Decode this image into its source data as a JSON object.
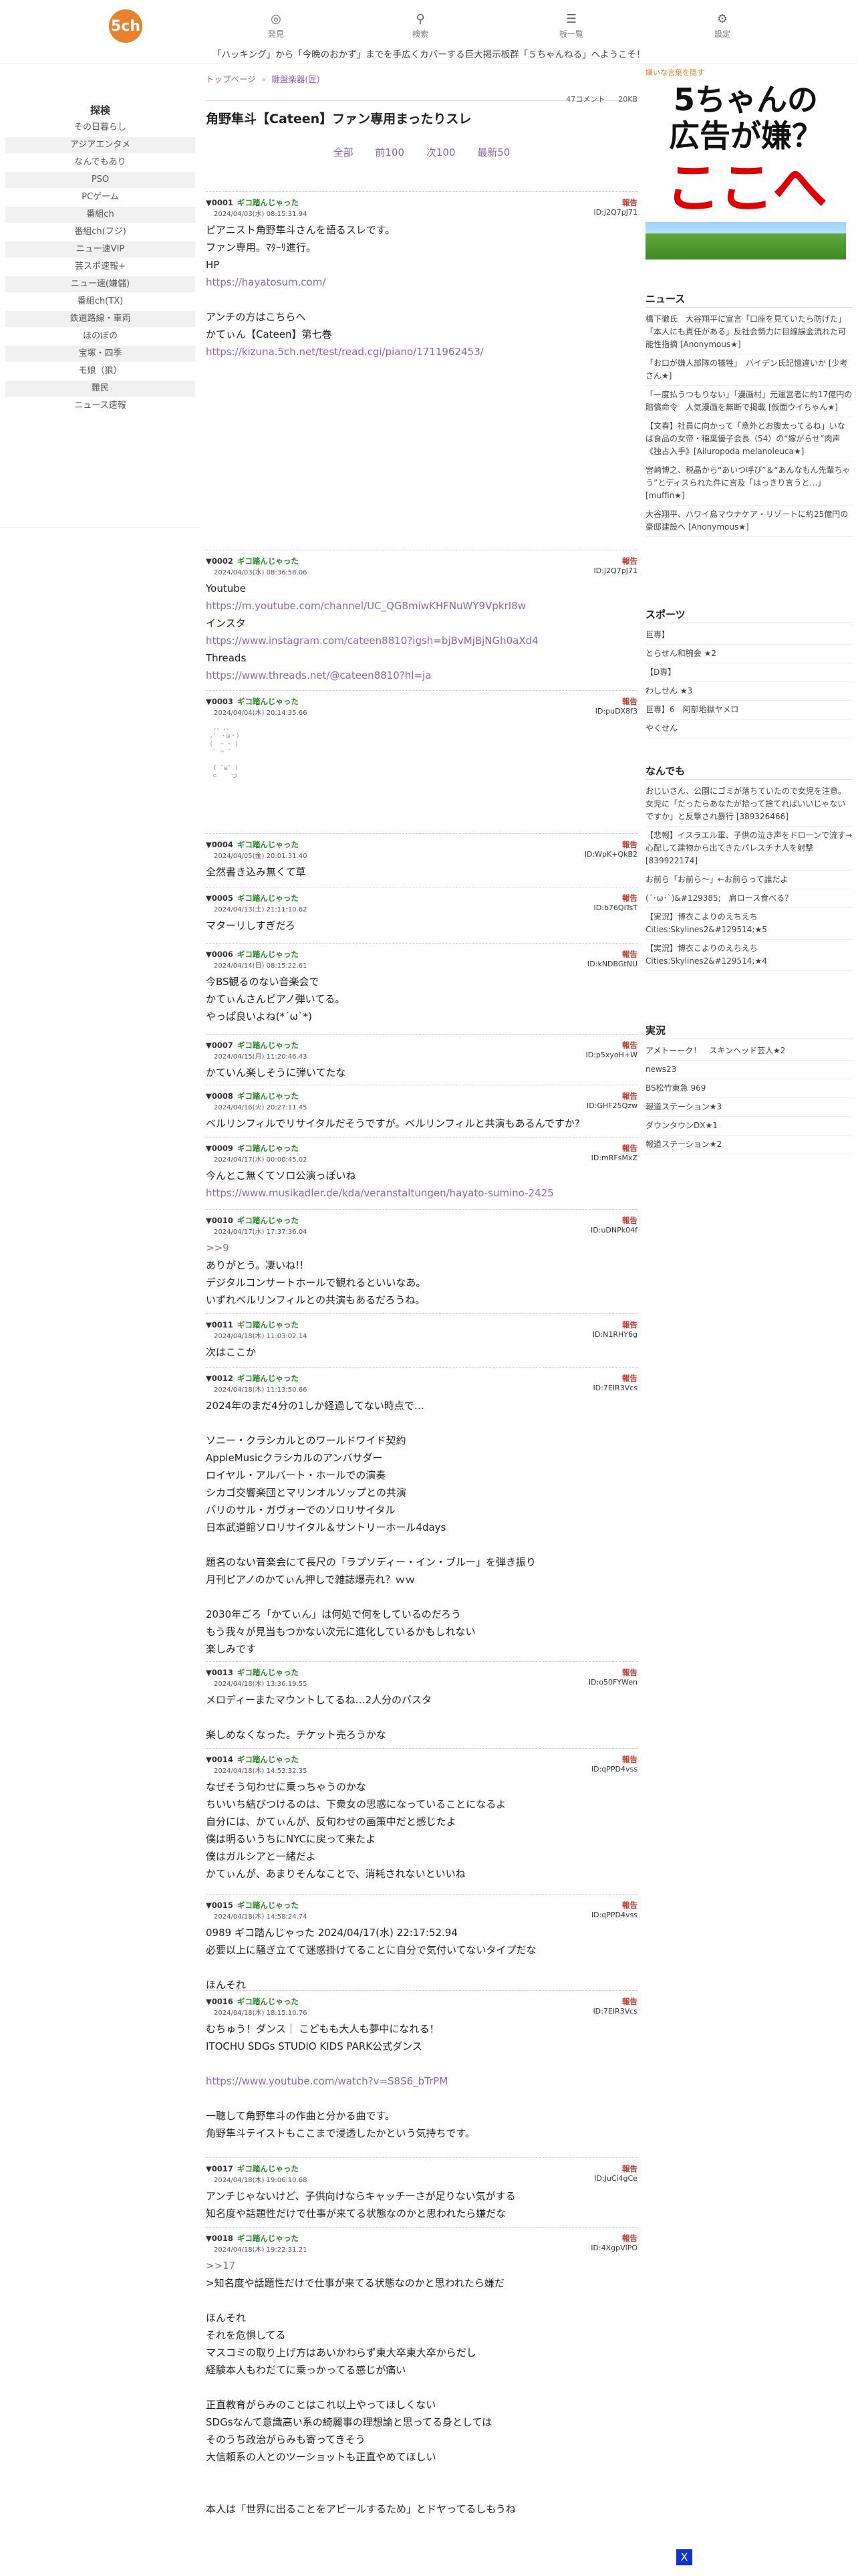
{
  "header": {
    "logo_text": "5ch",
    "nav": [
      {
        "label": "発見",
        "icon": "compass-icon",
        "glyph": "◎"
      },
      {
        "label": "検索",
        "icon": "search-icon",
        "glyph": "⚲"
      },
      {
        "label": "板一覧",
        "icon": "list-icon",
        "glyph": "☰"
      },
      {
        "label": "設定",
        "icon": "gear-icon",
        "glyph": "⚙"
      }
    ],
    "ticker": "「ハッキング」から「今晩のおかず」までを手広くカバーする巨大掲示板群「５ちゃんねる」へようこそ！"
  },
  "sidebar": {
    "heading": "探検",
    "items": [
      "その日暮らし",
      "アジアエンタメ",
      "なんでもあり",
      "PSO",
      "PCゲーム",
      "番組ch",
      "番組ch(フジ)",
      "ニュー速VIP",
      "芸スポ速報+",
      "ニュー速(嫌儲)",
      "番組ch(TX)",
      "鉄道路線・車両",
      "ほのぼの",
      "宝塚・四季",
      "モ娘（狼）",
      "難民",
      "ニュース速報"
    ]
  },
  "thread": {
    "breadcrumb": [
      "トップページ",
      "鍵盤楽器(匠)"
    ],
    "res_count": "47コメント",
    "size": "20KB",
    "title": "角野隼斗【Cateen】ファン専用まったりスレ",
    "pager": [
      "全部",
      "前100",
      "次100",
      "最新50"
    ],
    "reply_label": "報告",
    "posts": [
      {
        "no": "0001",
        "name": "ギコ踏んじゃった",
        "date": "2024/04/03(水) 08:15:31.94",
        "id": "ID:J2Q7pJ71",
        "lines": [
          "ピアニスト角野隼斗さんを語るスレです。",
          "ファン専用。ﾏﾀｰﾘ進行。",
          "HP",
          "https://hayatosum.com/",
          "",
          "アンチの方はこちらへ",
          "かてぃん【Cateen】第七巻",
          "https://kizuna.5ch.net/test/read.cgi/piano/1711962453/"
        ]
      },
      {
        "no": "0002",
        "name": "ギコ踏んじゃった",
        "date": "2024/04/03(水) 08:36:58.06",
        "id": "ID:J2Q7pJ71",
        "lines": [
          "Youtube",
          "https://m.youtube.com/channel/UC_QG8miwKHFNuWY9VpkrI8w",
          "インスタ",
          "https://www.instagram.com/cateen8810?igsh=bjBvMjBjNGh0aXd4",
          "Threads",
          "https://www.threads.net/@cateen8810?hl=ja"
        ]
      },
      {
        "no": "0003",
        "name": "ギコ踏んじゃった",
        "date": "2024/04/04(木) 20:14:35.66",
        "id": "ID:puDX8f3",
        "lines": []
      },
      {
        "no": "0004",
        "name": "ギコ踏んじゃった",
        "date": "2024/04/05(金) 20:01:31.40",
        "id": "ID:WpK+QkB2",
        "lines": [
          "全然書き込み無くて草"
        ]
      },
      {
        "no": "0005",
        "name": "ギコ踏んじゃった",
        "date": "2024/04/13(土) 21:11:10.62",
        "id": "ID:b76QiTsT",
        "lines": [
          "マターリしすぎだろ"
        ]
      },
      {
        "no": "0006",
        "name": "ギコ踏んじゃった",
        "date": "2024/04/14(日) 08:15:22.61",
        "id": "ID:kNDBGtNU",
        "lines": [
          "今BS観るのない音楽会で",
          "かてぃんさんピアノ弾いてる。",
          "やっぱ良いよね(*´ω`*)"
        ]
      },
      {
        "no": "0007",
        "name": "ギコ踏んじゃった",
        "date": "2024/04/15(月) 11:20:46.43",
        "id": "ID:p5xyoH+W",
        "lines": [
          "かていん楽しそうに弾いてたな"
        ]
      },
      {
        "no": "0008",
        "name": "ギコ踏んじゃった",
        "date": "2024/04/16(火) 20:27:11.45",
        "id": "ID:GHF25Qzw",
        "lines": [
          "ベルリンフィルでリサイタルだそうですが。ベルリンフィルと共演もあるんですか?"
        ]
      },
      {
        "no": "0009",
        "name": "ギコ踏んじゃった",
        "date": "2024/04/17(水) 00:00:45.02",
        "id": "ID:mRFsMxZ",
        "lines": [
          "今んとこ無くてソロ公演っぽいね",
          "https://www.musikadler.de/kda/veranstaltungen/hayato-sumino-2425"
        ]
      },
      {
        "no": "0010",
        "name": "ギコ踏んじゃった",
        "date": "2024/04/17(水) 17:37:36.04",
        "id": "ID:uDNPk04f",
        "lines": [
          ">>9",
          "ありがとう。凄いね!!",
          "デジタルコンサートホールで観れるといいなあ。",
          "いずれベルリンフィルとの共演もあるだろうね。"
        ]
      },
      {
        "no": "0011",
        "name": "ギコ踏んじゃった",
        "date": "2024/04/18(木) 11:03:02.14",
        "id": "ID:N1RHY6g",
        "lines": [
          "次はここか"
        ]
      },
      {
        "no": "0012",
        "name": "ギコ踏んじゃった",
        "date": "2024/04/18(木) 11:13:50.66",
        "id": "ID:7EIR3Vcs",
        "lines": [
          "2024年のまだ4分の1しか経過してない時点で…",
          "",
          "ソニー・クラシカルとのワールドワイド契約",
          "AppleMusicクラシカルのアンバサダー",
          "ロイヤル・アルバート・ホールでの演奏",
          "シカゴ交響楽団とマリンオルソップとの共演",
          "パリのサル・ガヴォーでのソロリサイタル",
          "日本武道館ソロリサイタル＆サントリーホール4days",
          "",
          "題名のない音楽会にて長尺の「ラプソディー・イン・ブルー」を弾き振り",
          "月刊ピアノのかてぃん押しで雑誌爆売れ？ｗｗ",
          "",
          "2030年ごろ「かてぃん」は何処で何をしているのだろう",
          "もう我々が見当もつかない次元に進化しているかもしれない",
          "楽しみです"
        ]
      },
      {
        "no": "0013",
        "name": "ギコ踏んじゃった",
        "date": "2024/04/18(木) 13:36:19.55",
        "id": "ID:o50FYWen",
        "lines": [
          "メロディーまたマウントしてるね…2人分のパスタ",
          "",
          "楽しめなくなった。チケット売ろうかな"
        ]
      },
      {
        "no": "0014",
        "name": "ギコ踏んじゃった",
        "date": "2024/04/18(木) 14:53:32.35",
        "id": "ID:qPPD4vss",
        "lines": [
          "なぜそう句わせに乗っちゃうのかな",
          "ちいいち結びつけるのは、下衆女の思惑になっていることになるよ",
          "自分には、かてぃんが、反旬わせの画策中だと感じたよ",
          "僕は明るいうちにNYCに戻って来たよ",
          "僕はガルシアと一緒だよ",
          "かてぃんが、あまりそんなことで、消耗されないといいね"
        ]
      },
      {
        "no": "0015",
        "name": "ギコ踏んじゃった",
        "date": "2024/04/18(木) 14:58:24.74",
        "id": "ID:qPPD4vss",
        "lines": [
          "0989 ギコ踏んじゃった 2024/04/17(水) 22:17:52.94",
          "必要以上に騒ぎ立てて迷惑掛けてることに自分で気付いてないタイプだな",
          "",
          "ほんそれ"
        ]
      },
      {
        "no": "0016",
        "name": "ギコ踏んじゃった",
        "date": "2024/04/18(木) 18:15:10.76",
        "id": "ID:7EIR3Vcs",
        "lines": [
          "むちゅう！ダンス｜ こどもも大人も夢中になれる！",
          "ITOCHU SDGs STUDIO KIDS PARK公式ダンス",
          "",
          "https://www.youtube.com/watch?v=S8S6_bTrPM",
          "",
          "一聴して角野隼斗の作曲と分かる曲です。",
          "角野隼斗テイストもここまで浸透したかという気持ちです。"
        ]
      },
      {
        "no": "0017",
        "name": "ギコ踏んじゃった",
        "date": "2024/04/18(木) 19:06:10.68",
        "id": "ID:JuCi4gCe",
        "lines": [
          "アンチじゃないけど、子供向けならキャッチーさが足りない気がする",
          "知名度や話題性だけで仕事が来てる状態なのかと思われたら嫌だな"
        ]
      },
      {
        "no": "0018",
        "name": "ギコ踏んじゃった",
        "date": "2024/04/18(木) 19:22:31.21",
        "id": "ID:4XgpVlPO",
        "lines": [
          ">>17",
          ">知名度や話題性だけで仕事が来てる状態なのかと思われたら嫌だ",
          "",
          "ほんそれ",
          "それを危惧してる",
          "マスコミの取り上げ方はあいかわらず東大卒東大卒からだし",
          "経験本人もわだてに乗っかってる感じが痛い",
          "",
          "正直教育がらみのことはこれ以上やってほしくない",
          "SDGsなんて意識高い系の綺麗事の理想論と思ってる身としては",
          "そのうち政治がらみも寄ってきそう",
          "大信頼系の人とのツーショットも正直やめてほしい",
          "",
          "",
          "本人は「世界に出ることをアピールするため」とドヤってるしもうね"
        ]
      }
    ]
  },
  "right": {
    "ad_caption": "嫌いな言葉を隠す",
    "ad": {
      "line1": "5ちゃんの",
      "line2": "広告が嫌？",
      "line3": "ここへ"
    },
    "sections": [
      {
        "title": "ニュース",
        "items": [
          "橋下徹氏　大谷翔平に宣言「口座を見ていたら防げた」「本人にも責任がある」反社会勢力に目線誤金流れた可能性指摘 [Anonymous★]",
          "「お口が嫌人部隊の犠牲」　バイデン氏記憶違いか [少考さん★]",
          "「一度払うつもりない」「漫画村」元運営者に約17億円の賠償命令　人気漫画を無断で掲載 [仮面ウイちゃん★]",
          "【文春】社員に向かって「意外とお腹太ってるね」いなば食品の女帝・稲葉優子会長（54）の“嫁がらせ”肉声《独占入手》[Ailuropoda melanoleuca★]",
          "宮崎博之、税晶から“あいつ呼び”＆“あんなもん先輩ちゃう”とディスられた件に言及「はっきり言うと…」[muffin★]",
          "大谷翔平、ハワイ島マウナケア・リゾートに約25億円の豪邸建設へ [Anonymous★]"
        ]
      },
      {
        "title": "スポーツ",
        "items": [
          "巨専】",
          "とらせん和腕会 ★2",
          "【D専】",
          "わしせん ★3",
          "巨専】6　阿部地獄ヤメロ",
          "やくせん"
        ]
      },
      {
        "title": "なんでも",
        "items": [
          "おじいさん、公園にゴミが落ちていたので女児を注意。女児に「だったらあなたが拾って捨てればいいじゃないですか」と反撃され暴行 [389326466]",
          "【悲報】イスラエル軍、子供の泣き声をドローンで流す→心配して建物から出てきたパレスチナ人を射撃 [839922174]",
          "お前ら「お前ら〜」←お前らって誰だよ",
          "(´･ω･`)&#129385;　肩ロース食べる？",
          "【実況】博衣こよりのえちえちCities:Skylines2&#129514;★5",
          "【実況】博衣こよりのえちえちCities:Skylines2&#129514;★4"
        ]
      },
      {
        "title": "実況",
        "items": [
          "アメトーーク！　スキンヘッド芸人★2",
          "news23",
          "BS松竹東急 969",
          "報道ステーション★3",
          "ダウンタウンDX★1",
          "報道ステーション★2"
        ]
      }
    ]
  },
  "close_button": "X"
}
